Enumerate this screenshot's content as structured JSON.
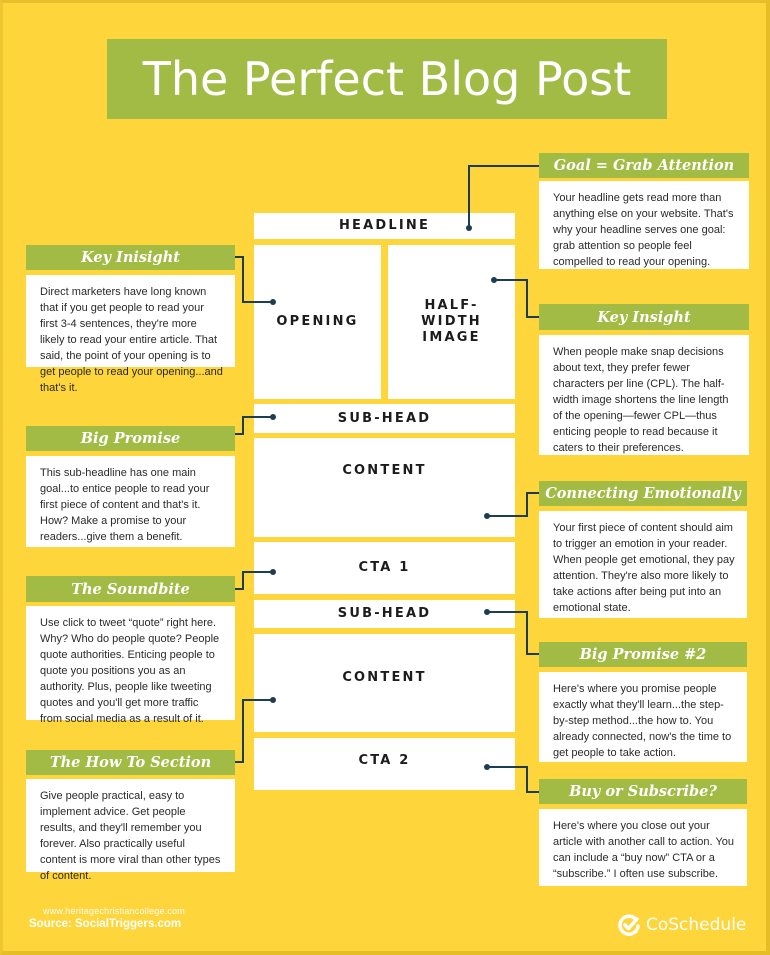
{
  "title": "The Perfect Blog Post",
  "colors": {
    "background": "#fed53a",
    "accent_green": "#a2bb45",
    "connector": "#1c3d52",
    "card_white": "#ffffff"
  },
  "blocks": {
    "headline": "HEADLINE",
    "opening": "OPENING",
    "half_width_image": "HALF-WIDTH IMAGE",
    "subhead_1": "SUB-HEAD",
    "content_1": "CONTENT",
    "cta_1": "CTA 1",
    "subhead_2": "SUB-HEAD",
    "content_2": "CONTENT",
    "cta_2": "CTA 2"
  },
  "cards": {
    "goal": {
      "heading": "Goal = Grab Attention",
      "body": "Your headline gets read more than anything else on your website. That's why your headline serves one goal: grab attention so people feel compelled to read your opening."
    },
    "key_inisight": {
      "heading": "Key Inisight",
      "body": "Direct marketers have long known that if you get people to read your first 3-4 sentences, they're more likely to read your entire article. That said, the point of your opening is to get people to read your opening...and that's it."
    },
    "key_insight": {
      "heading": "Key Insight",
      "body": "When people make snap decisions about text, they prefer fewer characters per line (CPL). The half-width image shortens the line length of the opening—fewer CPL—thus enticing people to read because it caters to their preferences."
    },
    "big_promise": {
      "heading": "Big Promise",
      "body": "This sub-headline has one main goal...to entice people to read your first piece of content and that's it. How? Make a promise to your readers...give them a benefit."
    },
    "connecting_emotionally": {
      "heading": "Connecting Emotionally",
      "body": "Your first piece of content should aim to trigger an emotion in your reader. When people get emotional, they pay attention. They're also more likely to take actions after being put into an emotional state."
    },
    "soundbite": {
      "heading": "The Soundbite",
      "body": "Use click to tweet “quote” right here. Why? Who do people quote? People quote authorities. Enticing people to quote you positions you as an authority. Plus, people like tweeting quotes and you'll get more traffic from social media as a result of it."
    },
    "big_promise_2": {
      "heading": "Big Promise #2",
      "body": "Here's where you promise people exactly what they'll learn...the step-by-step method...the how to. You already connected, now's the time to get people to take action."
    },
    "how_to": {
      "heading": "The How To Section",
      "body": "Give people practical, easy to implement advice. Get people results, and they'll remember you forever. Also practically useful content is more viral than other types of content."
    },
    "buy_subscribe": {
      "heading": "Buy or Subscribe?",
      "body": "Here's where you close out your article with another call to action. You can include a “buy now” CTA or a “subscribe.” I often use subscribe."
    }
  },
  "footer": {
    "url": "www.heritagechristiancollege.com",
    "source": "Source: SocialTriggers.com",
    "brand": "CoSchedule",
    "brand_icon": "coschedule-check-icon"
  }
}
